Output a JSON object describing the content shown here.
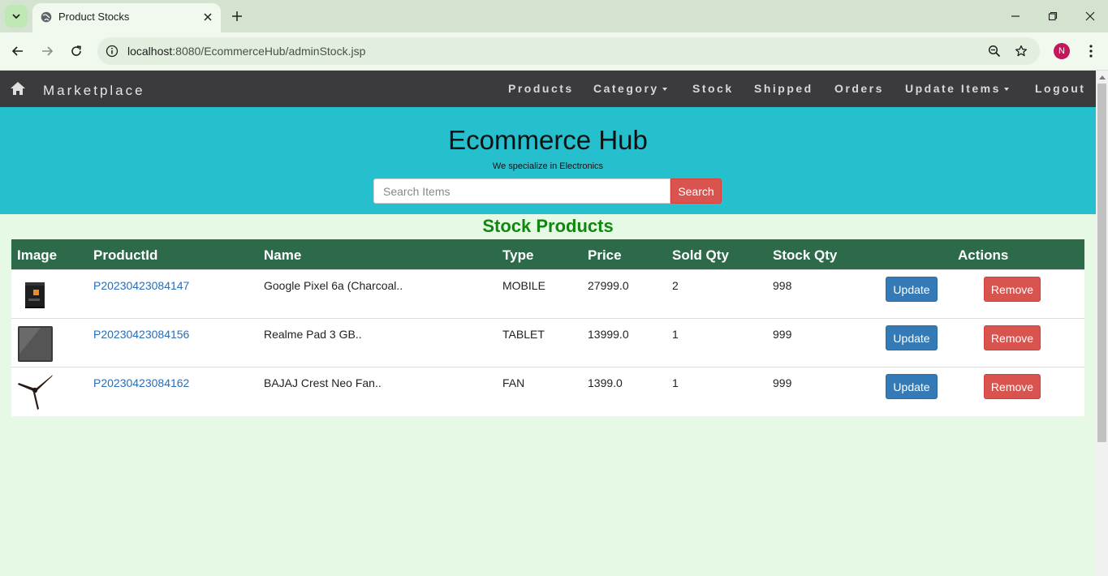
{
  "browser": {
    "tab_title": "Product Stocks",
    "url_host": "localhost",
    "url_path": ":8080/EcommerceHub/adminStock.jsp",
    "profile_initial": "N"
  },
  "navbar": {
    "brand": "Marketplace",
    "items": [
      {
        "label": "Products",
        "dropdown": false
      },
      {
        "label": "Category",
        "dropdown": true
      },
      {
        "label": "Stock",
        "dropdown": false
      },
      {
        "label": "Shipped",
        "dropdown": false
      },
      {
        "label": "Orders",
        "dropdown": false
      },
      {
        "label": "Update Items",
        "dropdown": true
      },
      {
        "label": "Logout",
        "dropdown": false
      }
    ]
  },
  "hero": {
    "title": "Ecommerce Hub",
    "subtitle": "We specialize in Electronics",
    "search_placeholder": "Search Items",
    "search_button": "Search"
  },
  "stock": {
    "title": "Stock Products",
    "columns": [
      "Image",
      "ProductId",
      "Name",
      "Type",
      "Price",
      "Sold Qty",
      "Stock Qty",
      "Actions"
    ],
    "rows": [
      {
        "image": "phone-box-thumbnail",
        "product_id": "P20230423084147",
        "name": "Google Pixel 6a (Charcoal..",
        "type": "MOBILE",
        "price": "27999.0",
        "sold_qty": "2",
        "stock_qty": "998",
        "update": "Update",
        "remove": "Remove"
      },
      {
        "image": "tablet-thumbnail",
        "product_id": "P20230423084156",
        "name": "Realme Pad 3 GB..",
        "type": "TABLET",
        "price": "13999.0",
        "sold_qty": "1",
        "stock_qty": "999",
        "update": "Update",
        "remove": "Remove"
      },
      {
        "image": "ceiling-fan-thumbnail",
        "product_id": "P20230423084162",
        "name": "BAJAJ Crest Neo Fan..",
        "type": "FAN",
        "price": "1399.0",
        "sold_qty": "1",
        "stock_qty": "999",
        "update": "Update",
        "remove": "Remove"
      }
    ]
  },
  "colors": {
    "navbar_bg": "#3b3b3d",
    "hero_bg": "#26bfcd",
    "page_bg": "#e6f9e4",
    "table_header_bg": "#2c6a49",
    "title_green": "#108810",
    "update_blue": "#337ab7",
    "remove_red": "#d9534f",
    "link_blue": "#2a6db5"
  }
}
